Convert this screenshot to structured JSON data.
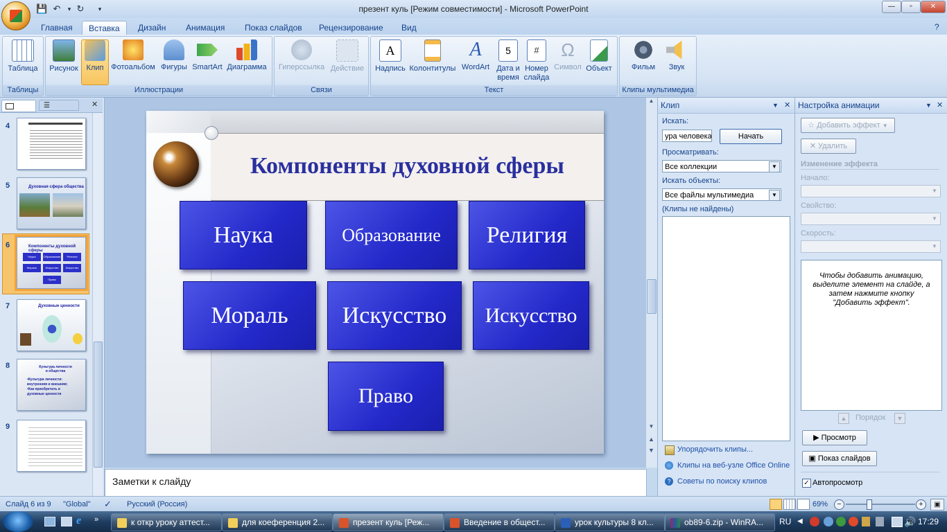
{
  "window": {
    "title": "презент куль [Режим совместимости] - Microsoft PowerPoint",
    "min": "—",
    "max": "▫",
    "close": "✕"
  },
  "tabs": [
    "Главная",
    "Вставка",
    "Дизайн",
    "Анимация",
    "Показ слайдов",
    "Рецензирование",
    "Вид"
  ],
  "active_tab": "Вставка",
  "ribbon": {
    "groups": [
      "Таблицы",
      "Иллюстрации",
      "Связи",
      "Текст",
      "Клипы мультимедиа"
    ],
    "buttons": {
      "table": "Таблица",
      "picture": "Рисунок",
      "clip": "Клип",
      "album": "Фотоальбом",
      "shapes": "Фигуры",
      "smartart": "SmartArt",
      "chart": "Диаграмма",
      "hyperlink": "Гиперссылка",
      "action": "Действие",
      "textbox": "Надпись",
      "headerfooter": "Колонтитулы",
      "wordart": "WordArt",
      "date1": "Дата и",
      "date2": "время",
      "num1": "Номер",
      "num2": "слайда",
      "symbol": "Символ",
      "object": "Объект",
      "movie": "Фильм",
      "sound": "Звук"
    }
  },
  "thumbnails": {
    "numbers": [
      "4",
      "5",
      "6",
      "7",
      "8",
      "9"
    ],
    "t5_title": "Духовная сфера общества",
    "t6_title": "Компоненты духовной сферы",
    "t6_boxes": [
      "Наука",
      "Образование",
      "Религия",
      "Мораль",
      "Искусство",
      "Искусство",
      "Право"
    ],
    "t7_title": "Духовные ценности",
    "t8_title": "Культура личности и общества",
    "t8_body": "•Культура личности: внутренняя и внешняя; •Как приобретать и духовные ценности"
  },
  "slide": {
    "title": "Компоненты духовной сферы",
    "boxes": [
      "Наука",
      "Образование",
      "Религия",
      "Мораль",
      "Искусство",
      "Искусство",
      "Право"
    ]
  },
  "notes_placeholder": "Заметки к слайду",
  "clip_pane": {
    "title": "Клип",
    "search_label": "Искать:",
    "search_value": "ура человека",
    "go_button": "Начать",
    "browse_label": "Просматривать:",
    "browse_value": "Все коллекции",
    "types_label": "Искать объекты:",
    "types_value": "Все файлы мультимедиа",
    "result": "(Клипы не найдены)",
    "links": [
      "Упорядочить клипы...",
      "Клипы на веб-узле Office Online",
      "Советы по поиску клипов"
    ]
  },
  "anim_pane": {
    "title": "Настройка анимации",
    "add_effect": "Добавить эффект",
    "remove": "Удалить",
    "change_effect": "Изменение эффекта",
    "start_label": "Начало:",
    "property_label": "Свойство:",
    "speed_label": "Скорость:",
    "hint": "Чтобы добавить анимацию, выделите элемент на слайде, а затем нажмите кнопку \"Добавить эффект\".",
    "order": "Порядок",
    "preview": "Просмотр",
    "slideshow": "Показ слайдов",
    "autopreview": "Автопросмотр"
  },
  "status": {
    "slide": "Слайд 6 из 9",
    "theme": "\"Global\"",
    "language": "Русский (Россия)",
    "zoom": "69%"
  },
  "taskbar": {
    "tasks": [
      "к откр уроку аттест...",
      "для коеференция 2...",
      "презент куль [Реж...",
      "Введение в общест...",
      "урок культуры 8 кл...",
      "ob89-6.zip - WinRA..."
    ],
    "lang": "RU",
    "time": "17:29"
  }
}
